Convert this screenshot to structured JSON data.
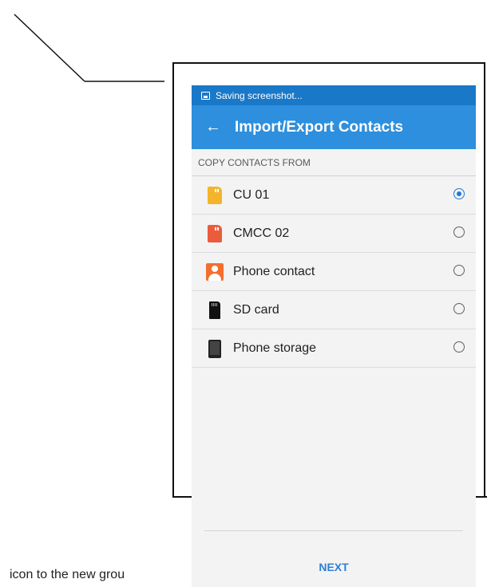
{
  "status_bar": {
    "text": "Saving screenshot..."
  },
  "app_bar": {
    "title": "Import/Export Contacts",
    "back_icon": "back-arrow-icon"
  },
  "section_header": "COPY CONTACTS FROM",
  "sources": [
    {
      "label": "CU 01",
      "icon": "sim-yellow-icon",
      "selected": true
    },
    {
      "label": "CMCC 02",
      "icon": "sim-red-icon",
      "selected": false
    },
    {
      "label": "Phone contact",
      "icon": "contact-icon",
      "selected": false
    },
    {
      "label": "SD card",
      "icon": "sd-card-icon",
      "selected": false
    },
    {
      "label": "Phone storage",
      "icon": "phone-storage-icon",
      "selected": false
    }
  ],
  "footer": {
    "next_label": "NEXT"
  },
  "caption": "icon to the new grou",
  "colors": {
    "status_bar": "#1a78c8",
    "app_bar": "#2d8fdd",
    "accent": "#1f7ad0"
  }
}
